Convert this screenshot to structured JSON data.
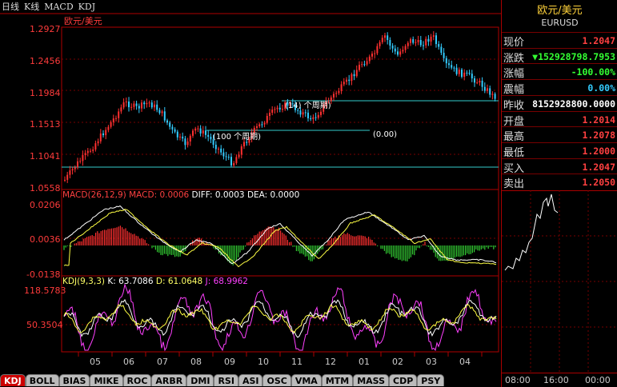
{
  "topbar": {
    "items": [
      "日线",
      "K线",
      "MACD",
      "KDJ"
    ]
  },
  "main": {
    "pair_label": "欧元/美元",
    "y_labels": [
      "1.2927",
      "1.2456",
      "1.1984",
      "1.1513",
      "1.1041",
      "1.0558"
    ],
    "annotations": [
      "(14) 个周期)",
      "(100 个周期)",
      "(0.00)"
    ]
  },
  "macd": {
    "title_params": "MACD(26,12,9)",
    "title_macd": "MACD: 0.0006",
    "title_diff": "DIFF: 0.0003",
    "title_dea": "DEA: 0.0000",
    "y_labels": [
      "0.0206",
      "0.0036",
      "-0.0138"
    ]
  },
  "kdj": {
    "title_params": "KDJ(9,3,3)",
    "title_k": "K: 63.7086",
    "title_d": "D: 61.0648",
    "title_j": "J: 68.9962",
    "y_labels": [
      "118.5783",
      "50.3504"
    ]
  },
  "x_axis": {
    "months": [
      "05",
      "06",
      "07",
      "08",
      "09",
      "10",
      "11",
      "12",
      "01",
      "02",
      "03",
      "04"
    ]
  },
  "tabs": [
    "KDJ",
    "BOLL",
    "BIAS",
    "MIKE",
    "ROC",
    "ARBR",
    "DMI",
    "RSI",
    "ASI",
    "OSC",
    "VMA",
    "MTM",
    "MASS",
    "CDP",
    "PSY"
  ],
  "info": {
    "title": "欧元/美元",
    "symbol": "EURUSD",
    "rows": [
      {
        "label": "现价",
        "value": "1.2047",
        "color": "#ff4040"
      },
      {
        "label": "涨跌",
        "value": "▼152928798.7953",
        "color": "#33ff33"
      },
      {
        "label": "涨幅",
        "value": "-100.00%",
        "color": "#33ff33"
      },
      {
        "label": "震幅",
        "value": "0.00%",
        "color": "#33ccff"
      },
      {
        "label": "昨收",
        "value": "8152928800.0000",
        "color": "#ffffff"
      },
      {
        "label": "开盘",
        "value": "1.2014",
        "color": "#ff4040"
      },
      {
        "label": "最高",
        "value": "1.2078",
        "color": "#ff4040"
      },
      {
        "label": "最低",
        "value": "1.2000",
        "color": "#ff4040"
      },
      {
        "label": "买入",
        "value": "1.2047",
        "color": "#ff4040"
      },
      {
        "label": "卖出",
        "value": "1.2050",
        "color": "#ff4040"
      }
    ],
    "time_labels": [
      "08:00",
      "16:00",
      "00:00"
    ]
  },
  "colors": {
    "up": "#ff3030",
    "down": "#33ccff",
    "frame": "#b00000",
    "line_white": "#ffffff",
    "line_yellow": "#ffff44",
    "line_magenta": "#ff40ff"
  }
}
